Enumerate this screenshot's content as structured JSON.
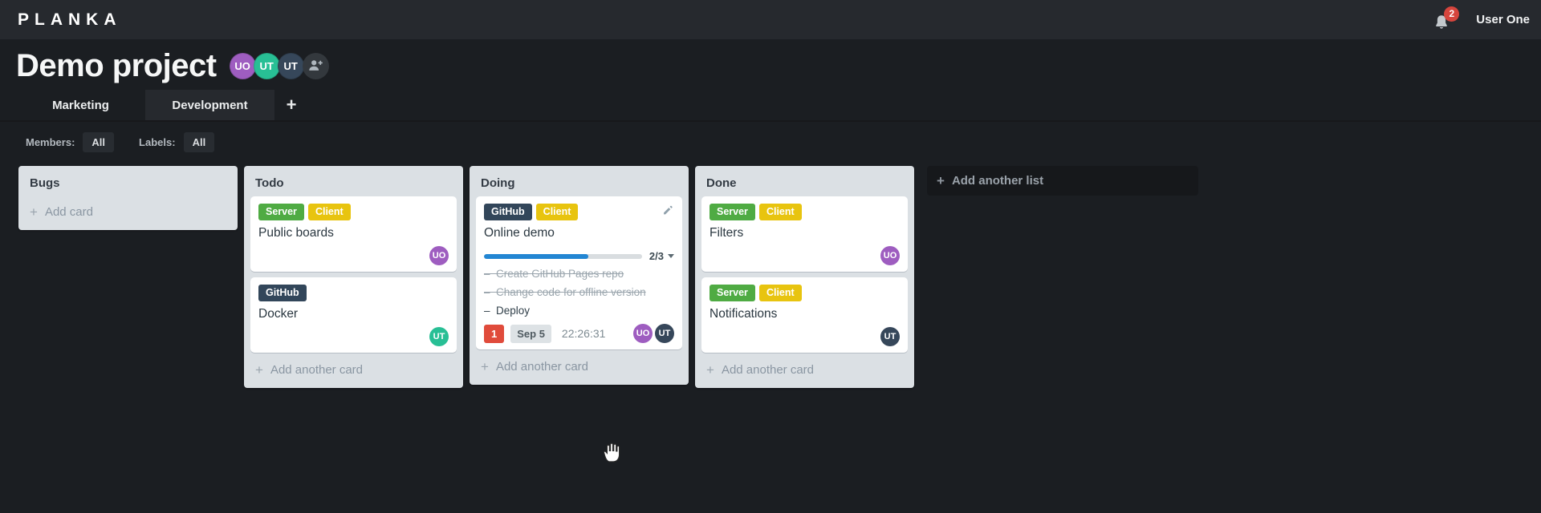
{
  "header": {
    "logo": "PLANKA",
    "notifications_count": "2",
    "user_name": "User One"
  },
  "icons": {
    "plus": "+"
  },
  "project": {
    "title": "Demo project",
    "members": [
      {
        "initials": "UO",
        "color": "#9e5dc0"
      },
      {
        "initials": "UT",
        "color": "#28bf95"
      },
      {
        "initials": "UT",
        "color": "#36475a"
      }
    ]
  },
  "tabs": [
    {
      "label": "Marketing",
      "active": false
    },
    {
      "label": "Development",
      "active": true
    }
  ],
  "filters": {
    "members_label": "Members:",
    "members_value": "All",
    "labels_label": "Labels:",
    "labels_value": "All"
  },
  "board": {
    "add_list_label": "Add another list",
    "lists": [
      {
        "title": "Bugs",
        "add_card_label": "Add card",
        "cards": []
      },
      {
        "title": "Todo",
        "add_card_label": "Add another card",
        "cards": [
          {
            "name": "Public boards",
            "labels": [
              {
                "text": "Server",
                "color": "#4fab43"
              },
              {
                "text": "Client",
                "color": "#e8c40f"
              }
            ],
            "members": [
              {
                "initials": "UO",
                "color": "#9e5dc0"
              }
            ]
          },
          {
            "name": "Docker",
            "labels": [
              {
                "text": "GitHub",
                "color": "#32465a"
              }
            ],
            "members": [
              {
                "initials": "UT",
                "color": "#28bf95"
              }
            ]
          }
        ]
      },
      {
        "title": "Doing",
        "add_card_label": "Add another card",
        "cards": [
          {
            "name": "Online demo",
            "show_edit_icon": true,
            "labels": [
              {
                "text": "GitHub",
                "color": "#32465a"
              },
              {
                "text": "Client",
                "color": "#e8c40f"
              }
            ],
            "progress": {
              "label": "2/3",
              "percent": 66,
              "color": "#2386d3"
            },
            "tasks": [
              {
                "text": "Create GitHub Pages repo",
                "done": true
              },
              {
                "text": "Change code for offline version",
                "done": true
              },
              {
                "text": "Deploy",
                "done": false
              }
            ],
            "notification_count": "1",
            "due_date": "Sep 5",
            "timer": "22:26:31",
            "members": [
              {
                "initials": "UO",
                "color": "#9e5dc0"
              },
              {
                "initials": "UT",
                "color": "#36475a"
              }
            ]
          }
        ]
      },
      {
        "title": "Done",
        "add_card_label": "Add another card",
        "cards": [
          {
            "name": "Filters",
            "labels": [
              {
                "text": "Server",
                "color": "#4fab43"
              },
              {
                "text": "Client",
                "color": "#e8c40f"
              }
            ],
            "members": [
              {
                "initials": "UO",
                "color": "#9e5dc0"
              }
            ]
          },
          {
            "name": "Notifications",
            "labels": [
              {
                "text": "Server",
                "color": "#4fab43"
              },
              {
                "text": "Client",
                "color": "#e8c40f"
              }
            ],
            "members": [
              {
                "initials": "UT",
                "color": "#36475a"
              }
            ]
          }
        ]
      }
    ]
  }
}
